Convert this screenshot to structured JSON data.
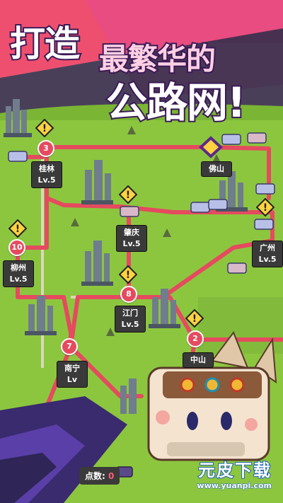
{
  "banner": {
    "part1": "打造",
    "part2": "最繁华的",
    "part3": "公路网!"
  },
  "cities": [
    {
      "name": "桂林",
      "level": "Lv.5"
    },
    {
      "name": "佛山",
      "level": ""
    },
    {
      "name": "肇庆",
      "level": "Lv.5"
    },
    {
      "name": "柳州",
      "level": "Lv.5"
    },
    {
      "name": "广州",
      "level": "Lv.5"
    },
    {
      "name": "江门",
      "level": "Lv.5"
    },
    {
      "name": "南宁",
      "level": "Lv"
    },
    {
      "name": "中山",
      "level": ""
    }
  ],
  "stops": [
    "3",
    "10",
    "8",
    "7",
    "2"
  ],
  "score": {
    "label": "点数:",
    "value": "0"
  },
  "watermark": {
    "title": "元皮下载",
    "url": "www.yuanpi.com"
  },
  "colors": {
    "grass": "#8cc63f",
    "road": "#e54a5f",
    "sign": "#3a3a3a"
  }
}
